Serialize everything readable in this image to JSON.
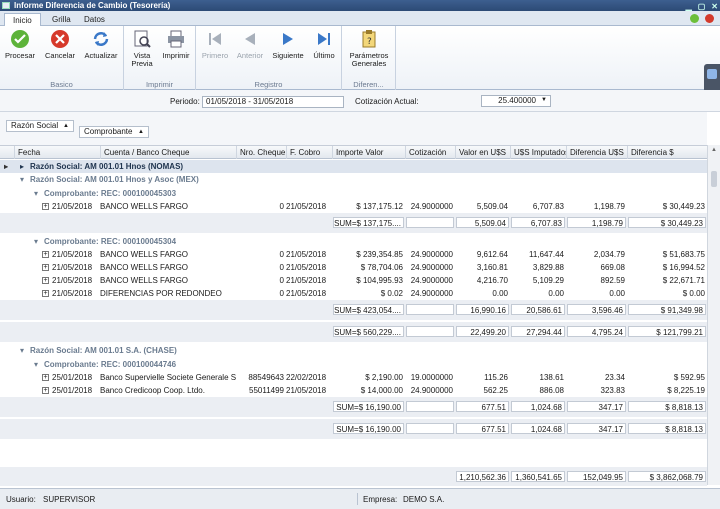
{
  "window": {
    "title": "Informe Diferencia de Cambio (Tesorería)"
  },
  "tabs": [
    "Inicio",
    "Grilla",
    "Datos"
  ],
  "ribbon": {
    "groups": [
      {
        "title": "Basico",
        "buttons": [
          "Procesar",
          "Cancelar",
          "Actualizar"
        ]
      },
      {
        "title": "Imprimir",
        "buttons": [
          "Vista Previa",
          "Imprimir"
        ]
      },
      {
        "title": "Registro",
        "buttons": [
          "Primero",
          "Anterior",
          "Siguiente",
          "Último"
        ]
      },
      {
        "title": "Diferen...",
        "buttons": [
          "Parámetros Generales"
        ]
      }
    ],
    "buttons": {
      "procesar": "Procesar",
      "cancelar": "Cancelar",
      "actualizar": "Actualizar",
      "vista1": "Vista",
      "vista2": "Previa",
      "imprimir": "Imprimir",
      "primero": "Primero",
      "anterior": "Anterior",
      "siguiente": "Siguiente",
      "ultimo": "Último",
      "param1": "Parámetros",
      "param2": "Generales"
    },
    "group_titles": {
      "basico": "Basico",
      "imprimir": "Imprimir",
      "registro": "Registro",
      "diferen": "Diferen..."
    }
  },
  "filters": {
    "periodo_label": "Periodo:",
    "periodo_value": "01/05/2018 - 31/05/2018",
    "cotizacion_label": "Cotización Actual:",
    "cotizacion_value": "25.400000"
  },
  "grouping": {
    "chip1": "Razón Social",
    "chip2": "Comprobante"
  },
  "columns": [
    "Fecha",
    "Cuenta / Banco Cheque",
    "Nro. Cheque",
    "F. Cobro",
    "Importe Valor",
    "Cotización",
    "Valor en U$S",
    "U$S Imputados",
    "Diferencia U$S",
    "Diferencia $"
  ],
  "rows": [
    {
      "kind": "g1",
      "text": "Razón Social: AM 001.01 Hnos  (NOMAS)"
    },
    {
      "kind": "g2",
      "text": "Razón Social: AM 001.01 Hnos y Asoc (MEX)"
    },
    {
      "kind": "g3",
      "text": "Comprobante: REC: 000100045303"
    },
    {
      "kind": "d",
      "cells": [
        "21/05/2018",
        "BANCO WELLS FARGO",
        "0",
        "21/05/2018",
        "$ 137,175.12",
        "24.9000000",
        "5,509.04",
        "6,707.83",
        "1,198.79",
        "$ 30,449.23"
      ]
    },
    {
      "kind": "s",
      "cells": [
        "SUM=$ 137,175....",
        "",
        "5,509.04",
        "6,707.83",
        "1,198.79",
        "$ 30,449.23"
      ]
    },
    {
      "kind": "g3",
      "text": "Comprobante: REC: 000100045304"
    },
    {
      "kind": "d",
      "cells": [
        "21/05/2018",
        "BANCO WELLS FARGO",
        "0",
        "21/05/2018",
        "$ 239,354.85",
        "24.9000000",
        "9,612.64",
        "11,647.44",
        "2,034.79",
        "$ 51,683.75"
      ]
    },
    {
      "kind": "d",
      "cells": [
        "21/05/2018",
        "BANCO WELLS FARGO",
        "0",
        "21/05/2018",
        "$ 78,704.06",
        "24.9000000",
        "3,160.81",
        "3,829.88",
        "669.08",
        "$ 16,994.52"
      ]
    },
    {
      "kind": "d",
      "cells": [
        "21/05/2018",
        "BANCO WELLS FARGO",
        "0",
        "21/05/2018",
        "$ 104,995.93",
        "24.9000000",
        "4,216.70",
        "5,109.29",
        "892.59",
        "$ 22,671.71"
      ]
    },
    {
      "kind": "d",
      "cells": [
        "21/05/2018",
        "DIFERENCIAS POR REDONDEO",
        "0",
        "21/05/2018",
        "$ 0.02",
        "24.9000000",
        "0.00",
        "0.00",
        "0.00",
        "$ 0.00"
      ]
    },
    {
      "kind": "s",
      "cells": [
        "SUM=$ 423,054....",
        "",
        "16,990.16",
        "20,586.61",
        "3,596.46",
        "$ 91,349.98"
      ]
    },
    {
      "kind": "s",
      "cells": [
        "SUM=$ 560,229....",
        "",
        "22,499.20",
        "27,294.44",
        "4,795.24",
        "$ 121,799.21"
      ]
    },
    {
      "kind": "g2",
      "text": "Razón Social: AM 001.01 S.A. (CHASE)"
    },
    {
      "kind": "g3",
      "text": "Comprobante: REC: 000100044746"
    },
    {
      "kind": "d",
      "cells": [
        "25/01/2018",
        "Banco Supervielle Societe Generale SA",
        "88549643",
        "22/02/2018",
        "$ 2,190.00",
        "19.0000000",
        "115.26",
        "138.61",
        "23.34",
        "$ 592.95"
      ]
    },
    {
      "kind": "d",
      "cells": [
        "25/01/2018",
        "Banco Credicoop Coop. Ltdo.",
        "55011499",
        "21/05/2018",
        "$ 14,000.00",
        "24.9000000",
        "562.25",
        "886.08",
        "323.83",
        "$ 8,225.19"
      ]
    },
    {
      "kind": "s",
      "cells": [
        "SUM=$ 16,190.00",
        "",
        "677.51",
        "1,024.68",
        "347.17",
        "$ 8,818.13"
      ]
    },
    {
      "kind": "s",
      "cells": [
        "SUM=$ 16,190.00",
        "",
        "677.51",
        "1,024.68",
        "347.17",
        "$ 8,818.13"
      ]
    }
  ],
  "totals": [
    "1,210,562.36",
    "1,360,541.65",
    "152,049.95",
    "$ 3,862,068.79"
  ],
  "status": {
    "usuario_label": "Usuario:",
    "usuario": "SUPERVISOR",
    "empresa_label": "Empresa:",
    "empresa": "DEMO S.A."
  },
  "colors": {
    "title_bar": "#2c4a75",
    "group_row": "#dde4ee",
    "accent": "#3a78c8"
  }
}
